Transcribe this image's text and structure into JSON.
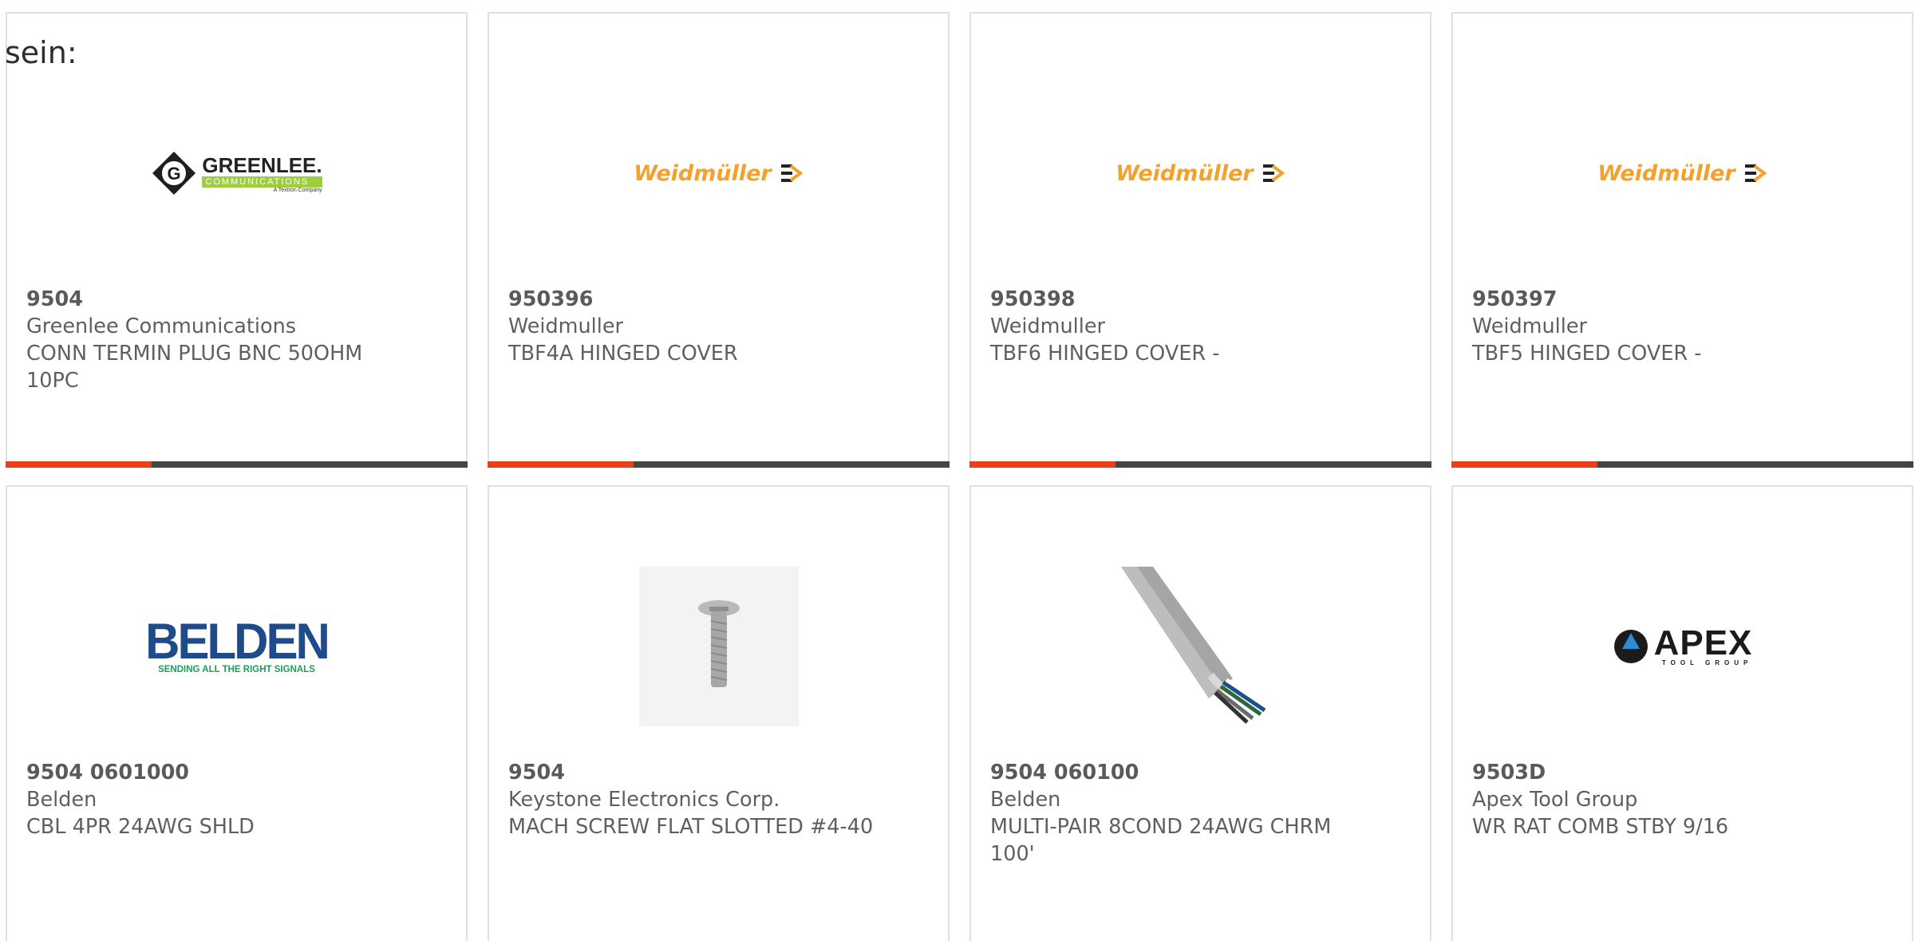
{
  "intro_text": "sein:",
  "colors": {
    "accent": "#e84117",
    "bar": "#454545",
    "text": "#5f5f5f"
  },
  "cards": [
    {
      "part": "9504",
      "brand": "Greenlee Communications",
      "desc": "CONN TERMIN PLUG BNC 50OHM 10PC",
      "logo": "greenlee-logo",
      "logo_text": {
        "name": "GREENLEE.",
        "sub": "COMMUNICATIONS",
        "tag": "A Textron Company"
      }
    },
    {
      "part": "950396",
      "brand": "Weidmuller",
      "desc": "TBF4A HINGED COVER",
      "logo": "weidmuller-logo",
      "logo_text": {
        "name": "Weidmüller"
      }
    },
    {
      "part": "950398",
      "brand": "Weidmuller",
      "desc": "TBF6 HINGED COVER -",
      "logo": "weidmuller-logo",
      "logo_text": {
        "name": "Weidmüller"
      }
    },
    {
      "part": "950397",
      "brand": "Weidmuller",
      "desc": "TBF5 HINGED COVER -",
      "logo": "weidmuller-logo",
      "logo_text": {
        "name": "Weidmüller"
      }
    },
    {
      "part": "9504 0601000",
      "brand": "Belden",
      "desc": "CBL 4PR 24AWG SHLD",
      "logo": "belden-logo",
      "logo_text": {
        "name": "BELDEN",
        "tag": "SENDING ALL THE RIGHT SIGNALS"
      }
    },
    {
      "part": "9504",
      "brand": "Keystone Electronics Corp.",
      "desc": "MACH SCREW FLAT SLOTTED #4-40",
      "logo": "screw-image"
    },
    {
      "part": "9504 060100",
      "brand": "Belden",
      "desc": "MULTI-PAIR 8COND 24AWG CHRM 100'",
      "logo": "cable-image"
    },
    {
      "part": "9503D",
      "brand": "Apex Tool Group",
      "desc": "WR RAT COMB STBY 9/16",
      "logo": "apex-logo",
      "logo_text": {
        "name": "APEX",
        "tag": "TOOL GROUP"
      }
    }
  ]
}
